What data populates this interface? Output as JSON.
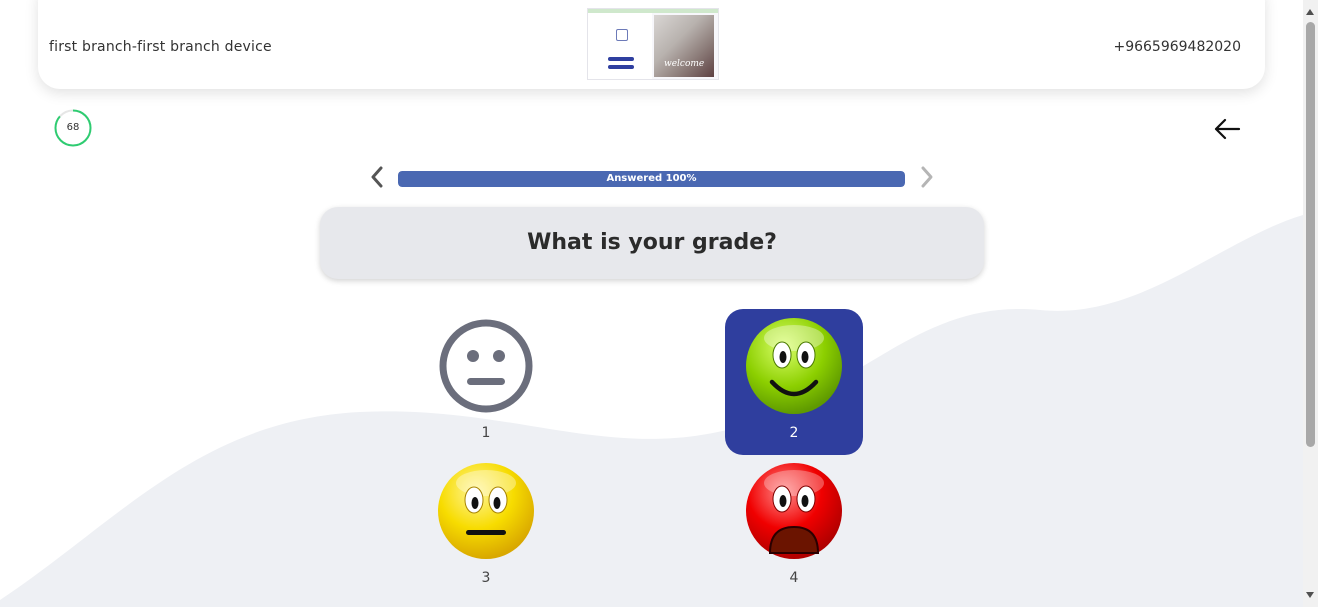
{
  "header": {
    "branch_device": "first branch-first branch device",
    "phone": "+9665969482020",
    "thumbnail_text": "welcome"
  },
  "timer": {
    "value": "68"
  },
  "progress": {
    "label": "Answered 100%",
    "percent": 100
  },
  "question": {
    "text": "What is your grade?"
  },
  "options": [
    {
      "label": "1",
      "face": "neutral-face-icon",
      "selected": false
    },
    {
      "label": "2",
      "face": "happy-face-icon",
      "selected": true
    },
    {
      "label": "3",
      "face": "meh-face-icon",
      "selected": false
    },
    {
      "label": "4",
      "face": "sad-face-icon",
      "selected": false
    }
  ],
  "colors": {
    "accent": "#2f3e9e",
    "progress": "#4a68b2",
    "timer_ring": "#2ecc71"
  }
}
